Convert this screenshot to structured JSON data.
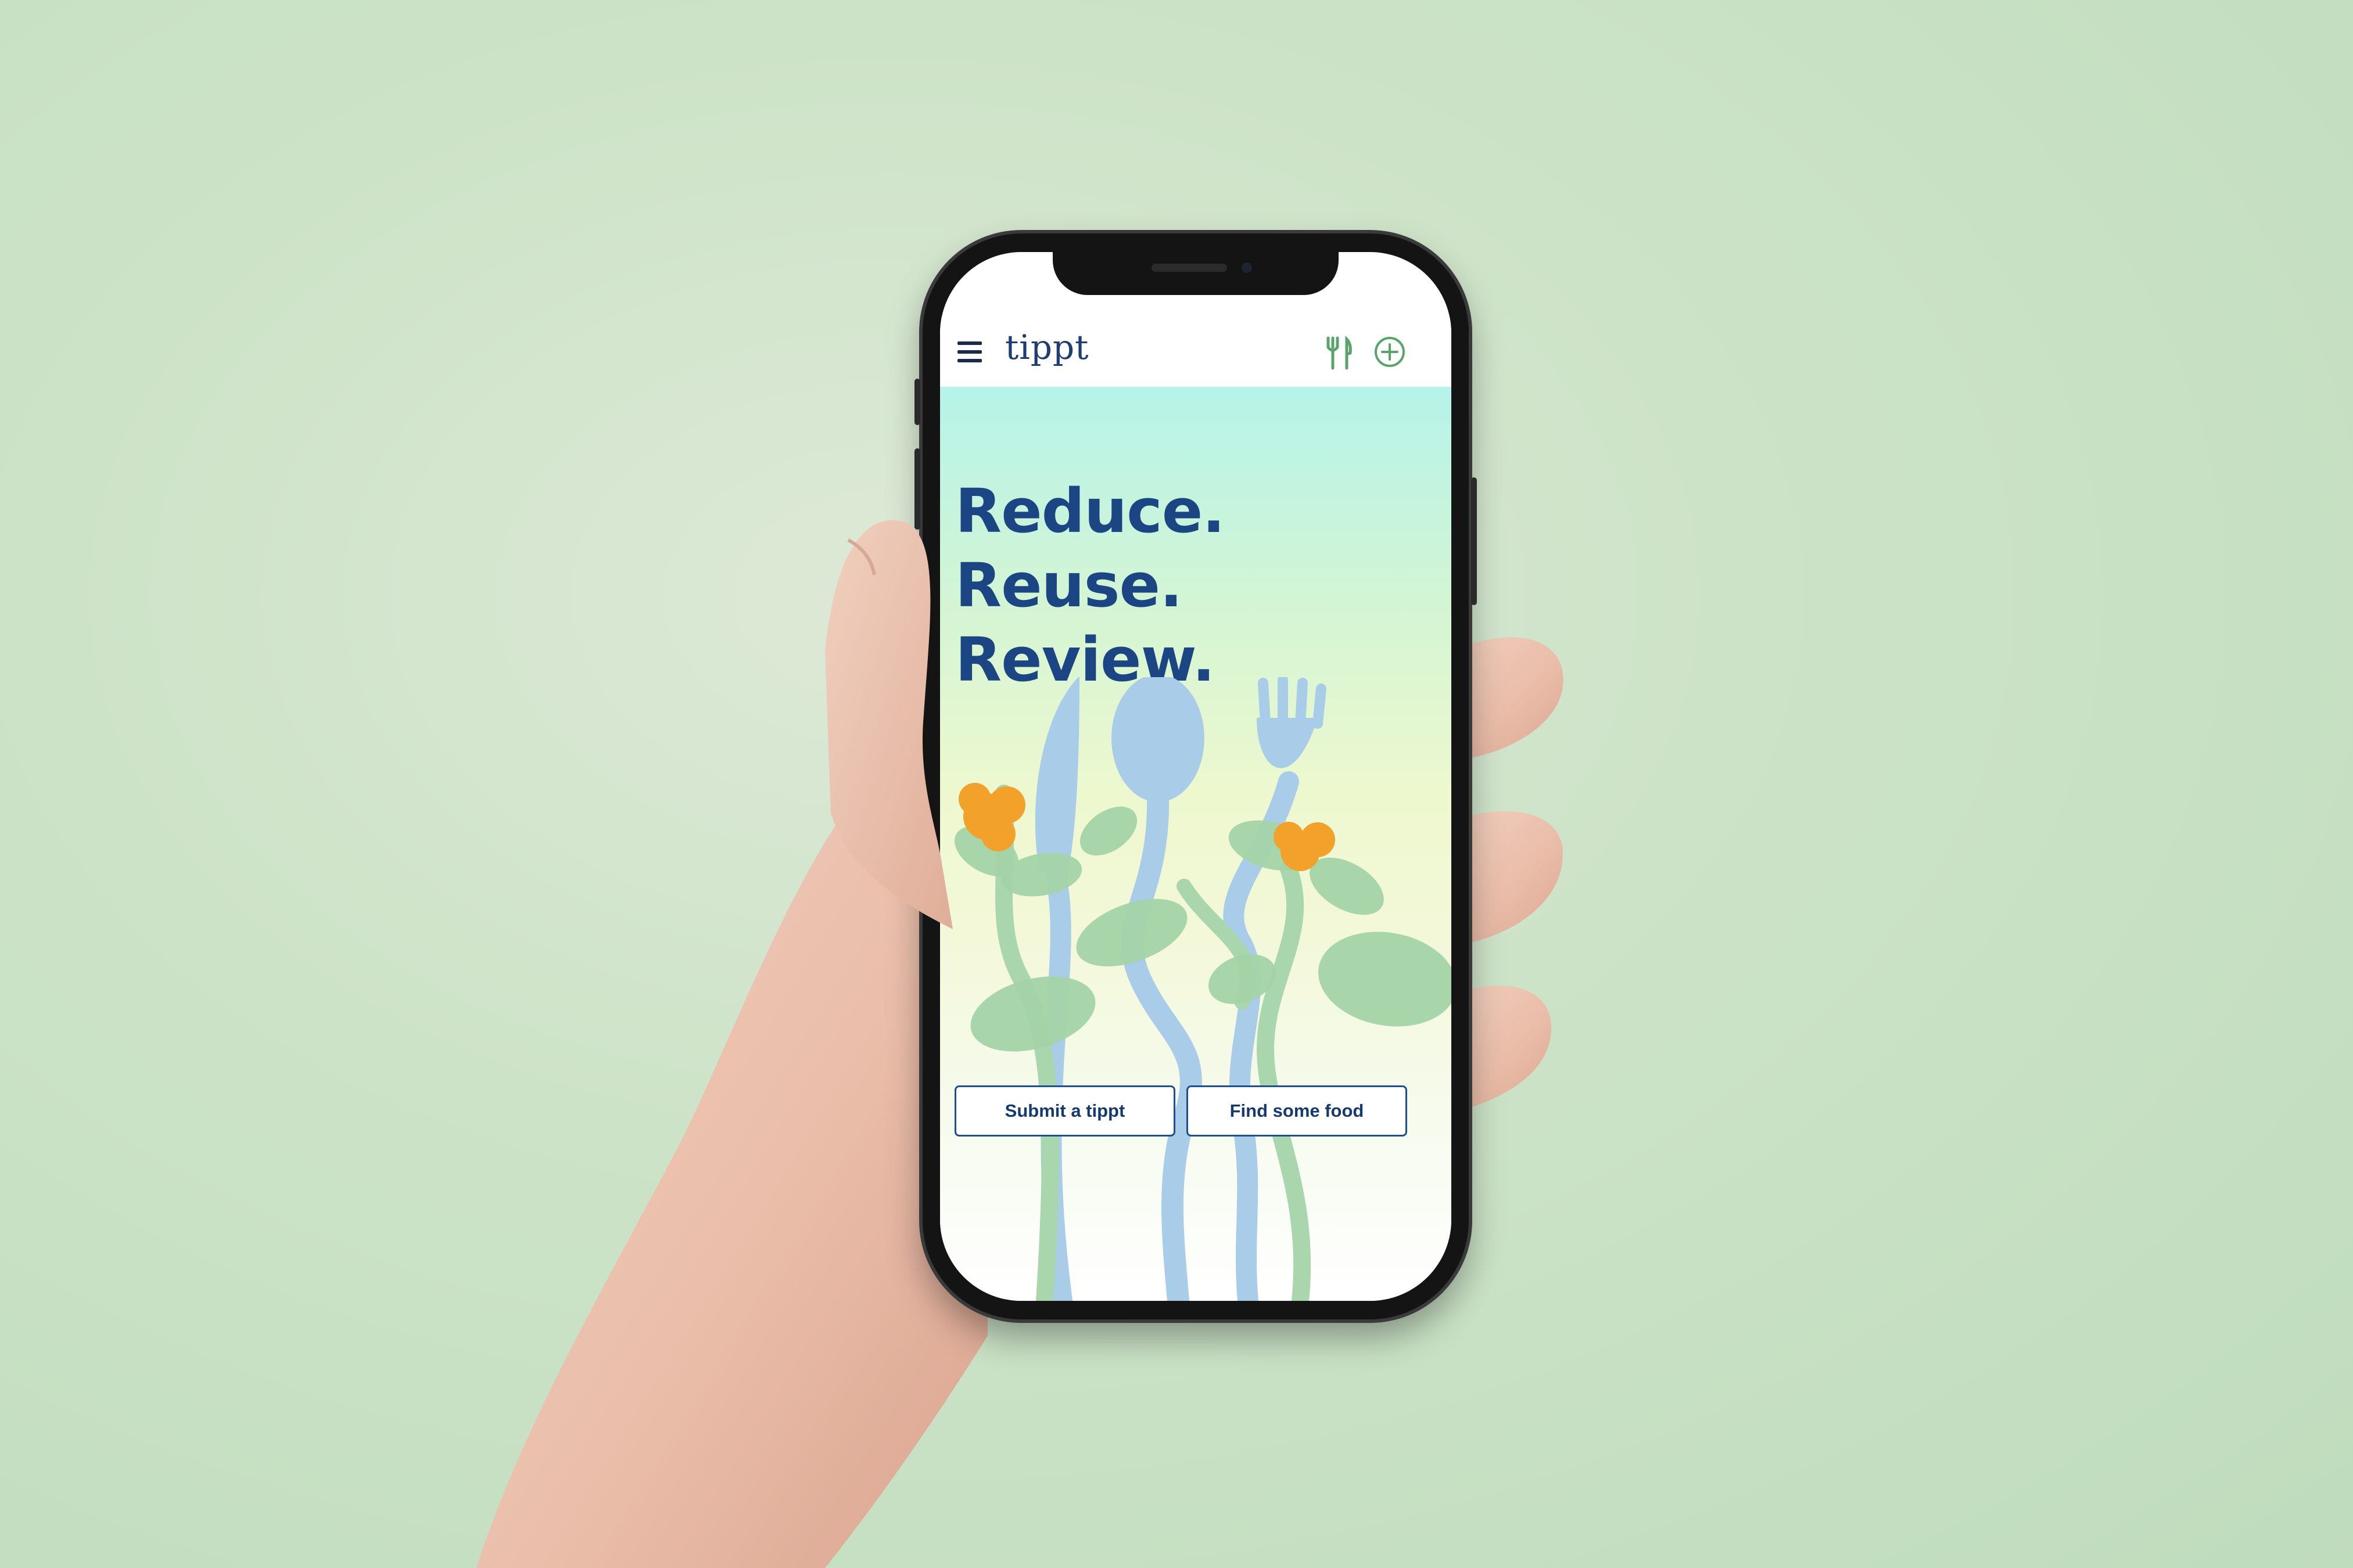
{
  "app": {
    "logo": "tippt",
    "header_icons": [
      "menu-icon",
      "cutlery-icon",
      "plus-circle-icon"
    ]
  },
  "hero": {
    "lines": [
      "Reduce.",
      "Reuse.",
      "Review."
    ]
  },
  "actions": {
    "submit_label": "Submit a tippt",
    "find_label": "Find some food"
  },
  "colors": {
    "background": "#c7e0c4",
    "brand_blue": "#1b4683",
    "icon_green": "#5aa36b",
    "flower_orange": "#f2a22a"
  }
}
